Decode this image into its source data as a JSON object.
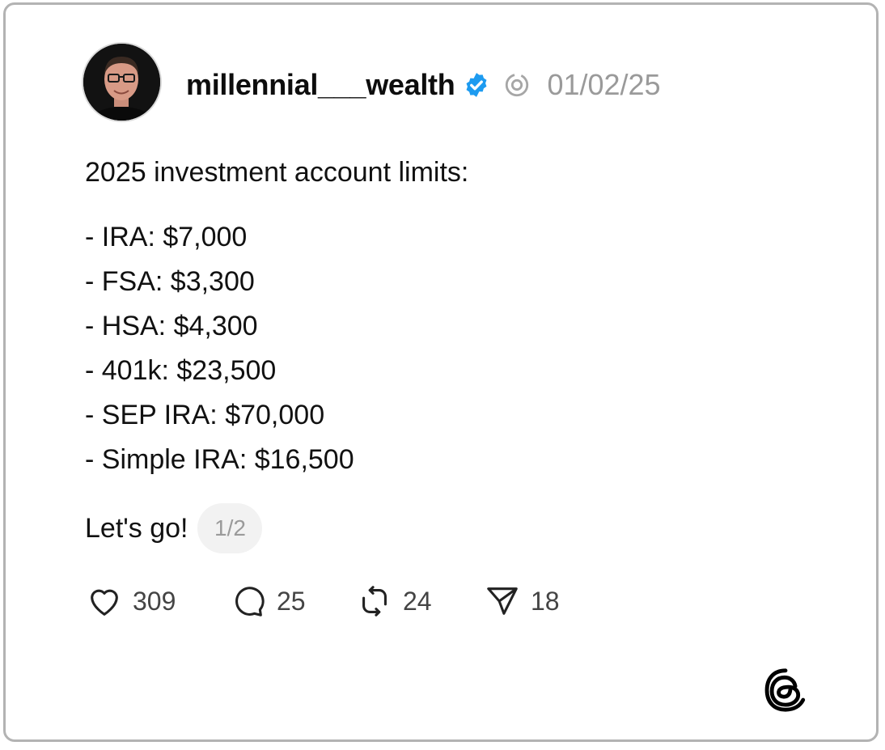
{
  "post": {
    "username": "millennial___wealth",
    "verified_icon": "verified-badge-icon",
    "thread_icon": "thread-indicator-icon",
    "date": "01/02/25",
    "intro": "2025 investment account limits:",
    "limits": [
      "- IRA: $7,000",
      "- FSA: $3,300",
      "- HSA: $4,300",
      "- 401k: $23,500",
      "- SEP IRA: $70,000",
      "- Simple IRA: $16,500"
    ],
    "outro": "Let's go!",
    "page_indicator": "1/2"
  },
  "actions": {
    "likes": "309",
    "replies": "25",
    "reposts": "24",
    "shares": "18"
  },
  "icons": {
    "like": "heart-icon",
    "reply": "comment-icon",
    "repost": "repost-icon",
    "share": "send-icon",
    "brand": "threads-logo-icon"
  },
  "colors": {
    "verified_blue": "#1d9bf0",
    "muted_text": "#9a9a9a",
    "card_border": "#b3b3b3"
  }
}
